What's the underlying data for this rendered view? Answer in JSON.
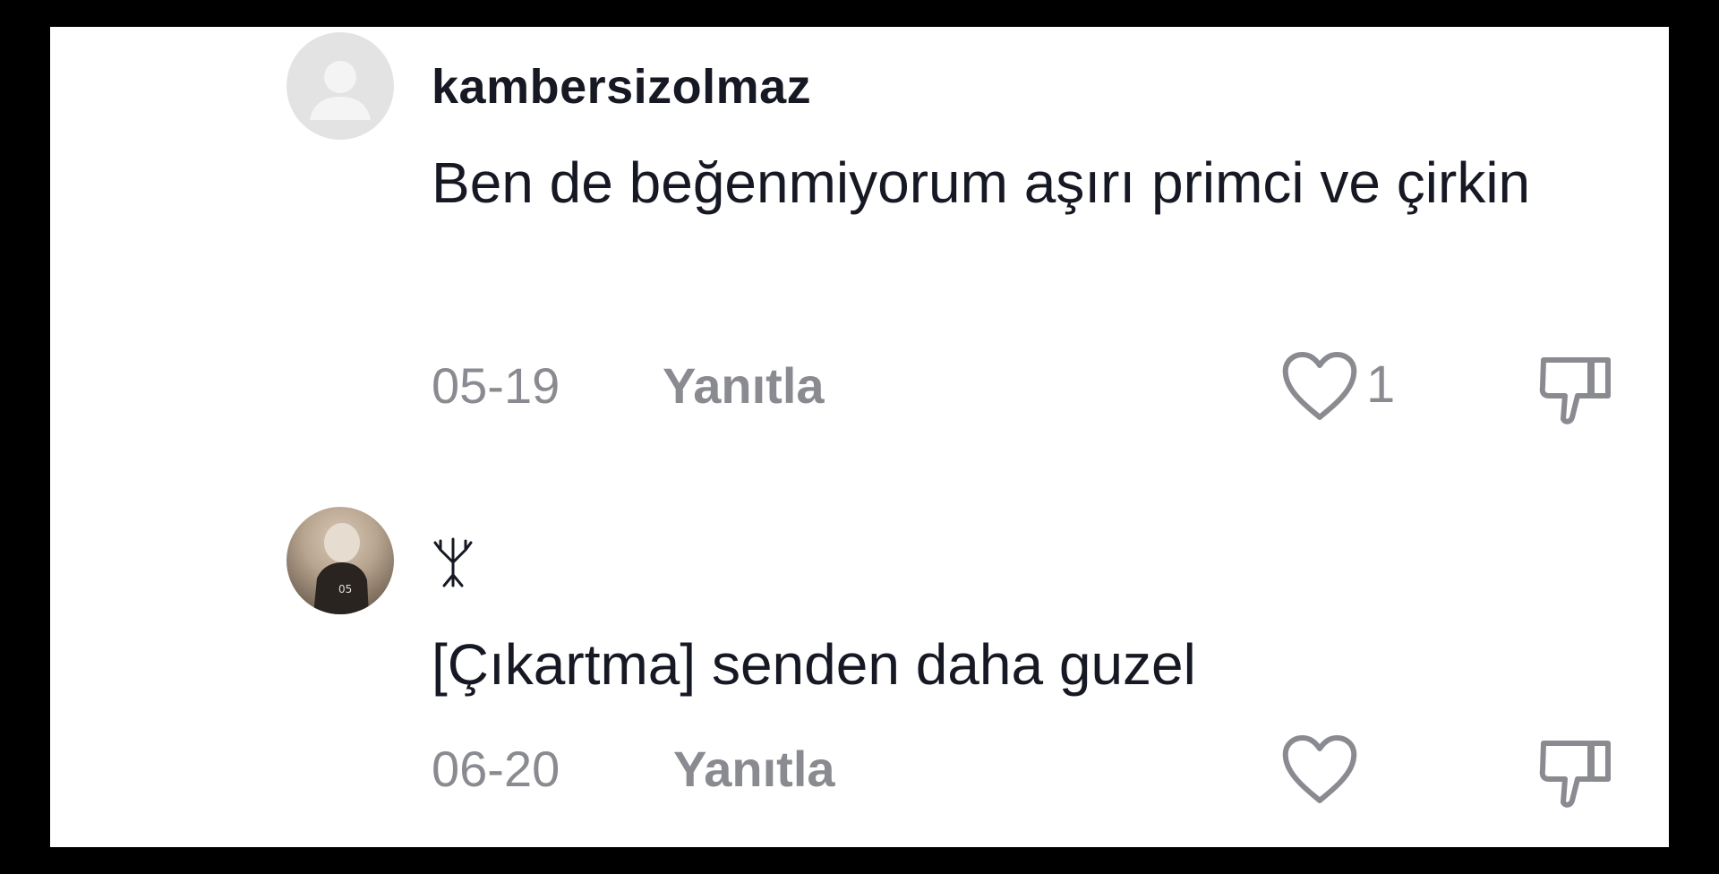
{
  "colors": {
    "frame": "#000000",
    "panel": "#ffffff",
    "text": "#161823",
    "muted": "#8a8b91",
    "avatar_default": "#e3e3e3"
  },
  "comments": [
    {
      "username": "kambersizolmaz",
      "avatar": "default-avatar-icon",
      "text": "Ben de beğenmiyorum aşırı primci ve çirkin",
      "date": "05-19",
      "reply_label": "Yanıtla",
      "like_count": "1",
      "like_icon": "heart-outline-icon",
      "dislike_icon": "thumbs-down-icon"
    },
    {
      "username": "",
      "username_icon": "tree-glyph-icon",
      "avatar": "user-photo-avatar",
      "text": "[Çıkartma] senden daha guzel",
      "date": "06-20",
      "reply_label": "Yanıtla",
      "like_count": "",
      "like_icon": "heart-outline-icon",
      "dislike_icon": "thumbs-down-icon"
    }
  ]
}
